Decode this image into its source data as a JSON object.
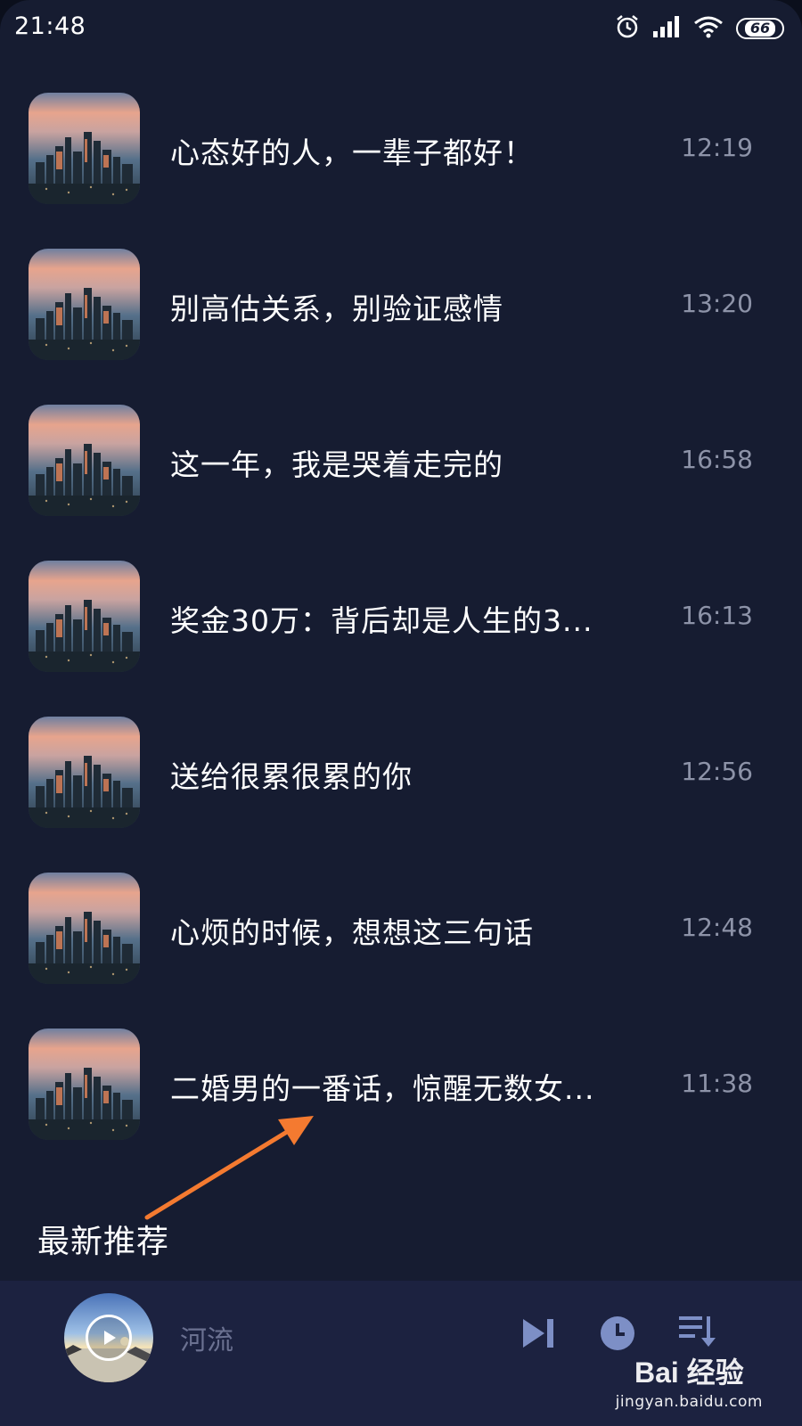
{
  "status_bar": {
    "time": "21:48",
    "battery": "66",
    "icons": [
      "alarm-icon",
      "signal-icon",
      "wifi-icon",
      "battery-icon"
    ]
  },
  "list": {
    "items": [
      {
        "title": "心态好的人，一辈子都好！",
        "time": "12:19"
      },
      {
        "title": "别高估关系，别验证感情",
        "time": "13:20"
      },
      {
        "title": "这一年，我是哭着走完的",
        "time": "16:58"
      },
      {
        "title": "奖金30万：背后却是人生的3...",
        "time": "16:13"
      },
      {
        "title": "送给很累很累的你",
        "time": "12:56"
      },
      {
        "title": "心烦的时候，想想这三句话",
        "time": "12:48"
      },
      {
        "title": "二婚男的一番话，惊醒无数女...",
        "time": "11:38"
      }
    ]
  },
  "section_label": "最新推荐",
  "player": {
    "title": "河流",
    "controls": [
      "play-icon",
      "next-icon",
      "timer-icon",
      "playlist-icon"
    ]
  },
  "watermark": {
    "logo": "Bai 经验",
    "url": "jingyan.baidu.com"
  },
  "colors": {
    "background": "#161c31",
    "player_bar": "#1c2240",
    "annotation_arrow": "#f47a30",
    "time_text": "#8d93a8"
  }
}
